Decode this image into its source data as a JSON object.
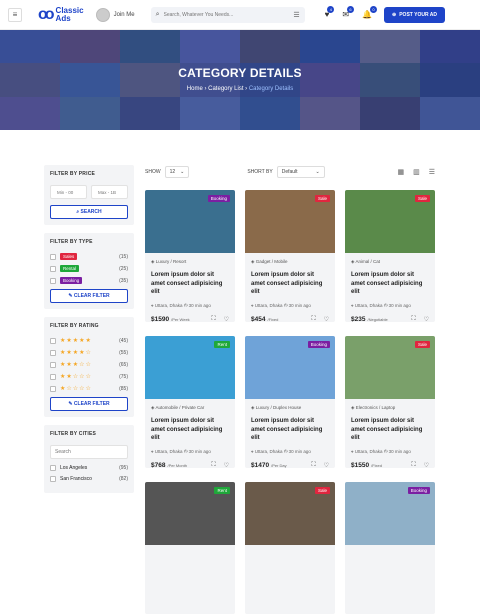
{
  "header": {
    "logo_mark": "oo",
    "logo_line1": "Classic",
    "logo_line2": "Ads",
    "user": "Join Me",
    "search_placeholder": "Search, Whatever You Needs...",
    "post_label": "POST YOUR AD",
    "badges": [
      "4",
      "6",
      "0"
    ]
  },
  "hero": {
    "title": "CATEGORY DETAILS",
    "crumbs": [
      "Home",
      "Category List",
      "Category Details"
    ],
    "sep": "›"
  },
  "toolbar": {
    "show_label": "SHOW",
    "show_value": "12",
    "sort_label": "SHORT BY",
    "sort_value": "Default"
  },
  "filters": {
    "price": {
      "title": "FILTER BY PRICE",
      "min": "Min - 00",
      "max": "Max - 1B",
      "button": "SEARCH"
    },
    "type": {
      "title": "FILTER BY TYPE",
      "items": [
        {
          "label": "Sales",
          "count": "(15)",
          "color": "#e0263f"
        },
        {
          "label": "Rental",
          "count": "(25)",
          "color": "#1fa83a"
        },
        {
          "label": "Booking",
          "count": "(35)",
          "color": "#7b1fa2"
        }
      ],
      "button": "CLEAR FILTER"
    },
    "rating": {
      "title": "FILTER BY RATING",
      "items": [
        {
          "stars": "★★★★★",
          "count": "(45)"
        },
        {
          "stars": "★★★★☆",
          "count": "(55)"
        },
        {
          "stars": "★★★☆☆",
          "count": "(65)"
        },
        {
          "stars": "★★☆☆☆",
          "count": "(75)"
        },
        {
          "stars": "★☆☆☆☆",
          "count": "(85)"
        }
      ],
      "button": "CLEAR FILTER"
    },
    "cities": {
      "title": "FILTER BY CITIES",
      "placeholder": "Search",
      "items": [
        {
          "label": "Los Angeles",
          "count": "(95)"
        },
        {
          "label": "San Francisco",
          "count": "(82)"
        }
      ]
    }
  },
  "cards": [
    {
      "tag": "Booking",
      "tag_color": "#7b1fa2",
      "meta": "Luxury / Resort",
      "title": "Lorem ipsum dolor sit amet consect adipisicing elit",
      "loc": "Uttara, Dhaka  ◷ 30 min ago",
      "price": "$1590",
      "unit": "/Per Week",
      "bg": "#3a6f8f"
    },
    {
      "tag": "Sale",
      "tag_color": "#e0263f",
      "meta": "Gadget / Mobile",
      "title": "Lorem ipsum dolor sit amet consect adipisicing elit",
      "loc": "Uttara, Dhaka  ◷ 30 min ago",
      "price": "$454",
      "unit": "/Fixed",
      "bg": "#8a6a4a"
    },
    {
      "tag": "Sale",
      "tag_color": "#e0263f",
      "meta": "Animal / Cat",
      "title": "Lorem ipsum dolor sit amet consect adipisicing elit",
      "loc": "Uttara, Dhaka  ◷ 30 min ago",
      "price": "$235",
      "unit": "/Negotiable",
      "bg": "#5a8a4a"
    },
    {
      "tag": "Rent",
      "tag_color": "#1fa83a",
      "meta": "Automobile / Private Car",
      "title": "Lorem ipsum dolor sit amet consect adipisicing elit",
      "loc": "Uttara, Dhaka  ◷ 30 min ago",
      "price": "$768",
      "unit": "/Per Month",
      "bg": "#3b9fd4"
    },
    {
      "tag": "Booking",
      "tag_color": "#7b1fa2",
      "meta": "Luxury / Duplex House",
      "title": "Lorem ipsum dolor sit amet consect adipisicing elit",
      "loc": "Uttara, Dhaka  ◷ 30 min ago",
      "price": "$1470",
      "unit": "/Per Day",
      "bg": "#6fa3d8"
    },
    {
      "tag": "Sale",
      "tag_color": "#e0263f",
      "meta": "Electronics / Laptop",
      "title": "Lorem ipsum dolor sit amet consect adipisicing elit",
      "loc": "Uttara, Dhaka  ◷ 30 min ago",
      "price": "$1550",
      "unit": "/Fixed",
      "bg": "#7aa06a"
    },
    {
      "tag": "Rent",
      "tag_color": "#1fa83a",
      "meta": "",
      "title": "",
      "loc": "",
      "price": "",
      "unit": "",
      "bg": "#555"
    },
    {
      "tag": "Sale",
      "tag_color": "#e0263f",
      "meta": "",
      "title": "",
      "loc": "",
      "price": "",
      "unit": "",
      "bg": "#6a5a4a"
    },
    {
      "tag": "Booking",
      "tag_color": "#7b1fa2",
      "meta": "",
      "title": "",
      "loc": "",
      "price": "",
      "unit": "",
      "bg": "#8fb0c8"
    }
  ]
}
